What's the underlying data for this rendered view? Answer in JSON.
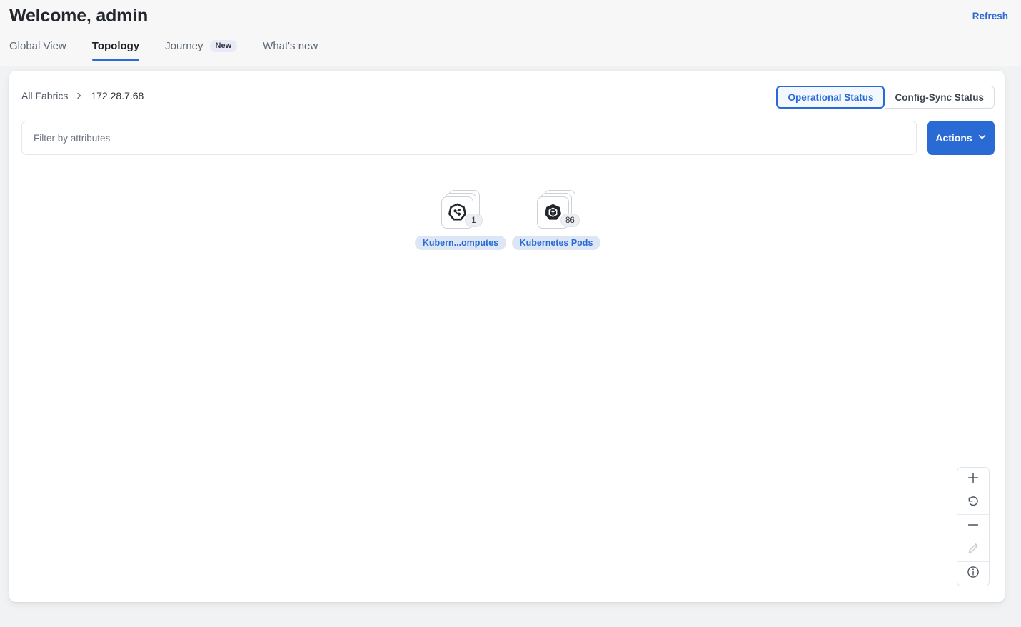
{
  "header": {
    "title": "Welcome, admin",
    "refresh_label": "Refresh",
    "tabs": [
      {
        "label": "Global View",
        "active": false,
        "badge": ""
      },
      {
        "label": "Topology",
        "active": true,
        "badge": ""
      },
      {
        "label": "Journey",
        "active": false,
        "badge": "New"
      },
      {
        "label": "What's new",
        "active": false,
        "badge": ""
      }
    ]
  },
  "breadcrumb": {
    "root": "All Fabrics",
    "separator_icon": "chevron-right-icon",
    "current": "172.28.7.68"
  },
  "status_toggle": {
    "operational_label": "Operational Status",
    "config_sync_label": "Config-Sync Status",
    "selected": "Operational Status"
  },
  "filter": {
    "placeholder": "Filter by attributes",
    "value": ""
  },
  "actions": {
    "label": "Actions",
    "chevron_icon": "chevron-down-icon"
  },
  "topology": {
    "nodes": [
      {
        "label": "Kubern...omputes",
        "count": "1",
        "icon": "kubernetes-compute-icon"
      },
      {
        "label": "Kubernetes Pods",
        "count": "86",
        "icon": "kubernetes-pod-icon"
      }
    ]
  },
  "zoom_controls": [
    {
      "name": "zoom-in-button",
      "icon": "plus-icon",
      "enabled": true
    },
    {
      "name": "reset-view-button",
      "icon": "undo-arrow-icon",
      "enabled": true
    },
    {
      "name": "zoom-out-button",
      "icon": "minus-icon",
      "enabled": true
    },
    {
      "name": "edit-button",
      "icon": "pencil-icon",
      "enabled": false
    },
    {
      "name": "info-button",
      "icon": "info-circle-icon",
      "enabled": true
    }
  ],
  "colors": {
    "accent": "#2a6ad4",
    "page_bg": "#f1f2f3",
    "header_bg": "#f7f7f8",
    "card_bg": "#ffffff",
    "node_label_bg": "#dde6f5",
    "badge_new_bg": "#e8eaf8"
  }
}
